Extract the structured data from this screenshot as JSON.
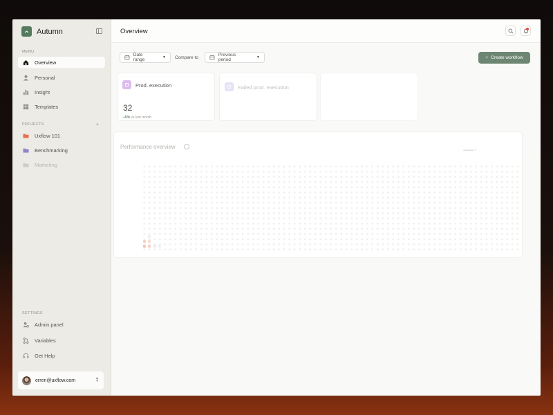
{
  "app": {
    "name": "Autumn"
  },
  "sidebar": {
    "menu_label": "MENU",
    "menu": [
      {
        "label": "Overview",
        "icon": "home-icon",
        "active": true
      },
      {
        "label": "Personal",
        "icon": "user-icon"
      },
      {
        "label": "Insight",
        "icon": "bar-chart-icon"
      },
      {
        "label": "Templates",
        "icon": "grid-icon"
      }
    ],
    "projects_label": "PROJECTS",
    "projects": [
      {
        "label": "Uxflow 101",
        "color": "#e8714f"
      },
      {
        "label": "Benchmarking",
        "color": "#8f85cf"
      },
      {
        "label": "Marketing",
        "color": "#c9c7c1"
      }
    ],
    "settings_label": "SETTINGS",
    "settings": [
      {
        "label": "Admin panel",
        "icon": "admin-icon"
      },
      {
        "label": "Variables",
        "icon": "variables-icon"
      },
      {
        "label": "Get Help",
        "icon": "headset-icon"
      }
    ],
    "user_email": "erren@uxflow.com"
  },
  "header": {
    "title": "Overview"
  },
  "filters": {
    "date_range": "Date range",
    "compare_label": "Compare to",
    "previous_period": "Previous period"
  },
  "actions": {
    "create_workflow": "Create workflow"
  },
  "cards": [
    {
      "title": "Prod. execution",
      "value": "32",
      "delta": "+5%",
      "delta_suffix": "vs last month",
      "icon_color": "#d9b8ec"
    },
    {
      "title": "Failed prod. execution",
      "icon_color": "#e4e0f7"
    }
  ],
  "performance": {
    "title": "Performance overview"
  },
  "colors": {
    "accent": "#6d8672",
    "sidebar_bg": "#ecebe5",
    "notify": "#e04b3a"
  }
}
